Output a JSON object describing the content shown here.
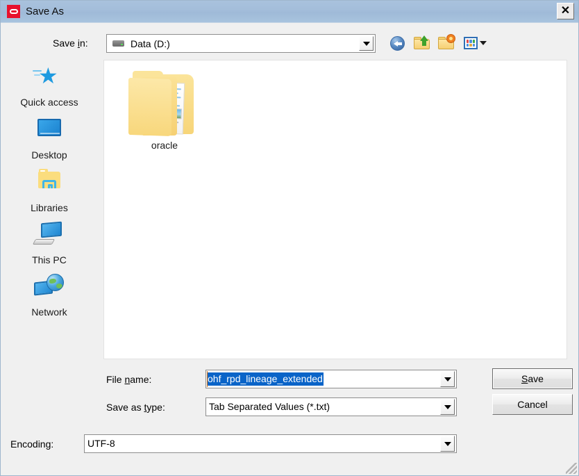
{
  "window": {
    "title": "Save As",
    "app_icon": "oracle-logo-icon",
    "close_label": "✕"
  },
  "toolbar": {
    "savein_label_pre": "Save ",
    "savein_label_accel": "i",
    "savein_label_post": "n:",
    "savein_value": "Data (D:)",
    "buttons": [
      {
        "name": "back-button",
        "icon": "back-arrow-icon",
        "tooltip": "Back"
      },
      {
        "name": "up-one-level-button",
        "icon": "up-folder-icon",
        "tooltip": "Up One Level"
      },
      {
        "name": "create-new-folder-button",
        "icon": "new-folder-icon",
        "tooltip": "Create New Folder"
      },
      {
        "name": "views-button",
        "icon": "views-grid-icon",
        "tooltip": "View Menu"
      }
    ]
  },
  "places": [
    {
      "label": "Quick access",
      "icon": "quick-access-star-icon"
    },
    {
      "label": "Desktop",
      "icon": "desktop-monitor-icon"
    },
    {
      "label": "Libraries",
      "icon": "libraries-folder-icon"
    },
    {
      "label": "This PC",
      "icon": "this-pc-icon"
    },
    {
      "label": "Network",
      "icon": "network-globe-icon"
    }
  ],
  "files": [
    {
      "name": "oracle",
      "type": "folder",
      "icon": "open-folder-icon"
    }
  ],
  "form": {
    "filename_label_pre": "File ",
    "filename_label_accel": "n",
    "filename_label_post": "ame:",
    "filename_value": "ohf_rpd_lineage_extended",
    "filename_placeholder": "",
    "savetype_label_pre": "Save as ",
    "savetype_label_accel": "t",
    "savetype_label_post": "ype:",
    "savetype_value": "Tab Separated Values (*.txt)",
    "encoding_label": "Encoding:",
    "encoding_value": "UTF-8"
  },
  "buttons": {
    "save_accel": "S",
    "save_rest": "ave",
    "cancel_label": "Cancel"
  },
  "colors": {
    "titlebar_top": "#a9c2dd",
    "titlebar_bottom": "#a8c3de",
    "app_icon_red": "#e8112d",
    "dialog_face": "#f0f0f0",
    "selection_blue": "#0a64c8",
    "caret_orange": "#e07b18",
    "folder_yellow": "#f7d579"
  }
}
